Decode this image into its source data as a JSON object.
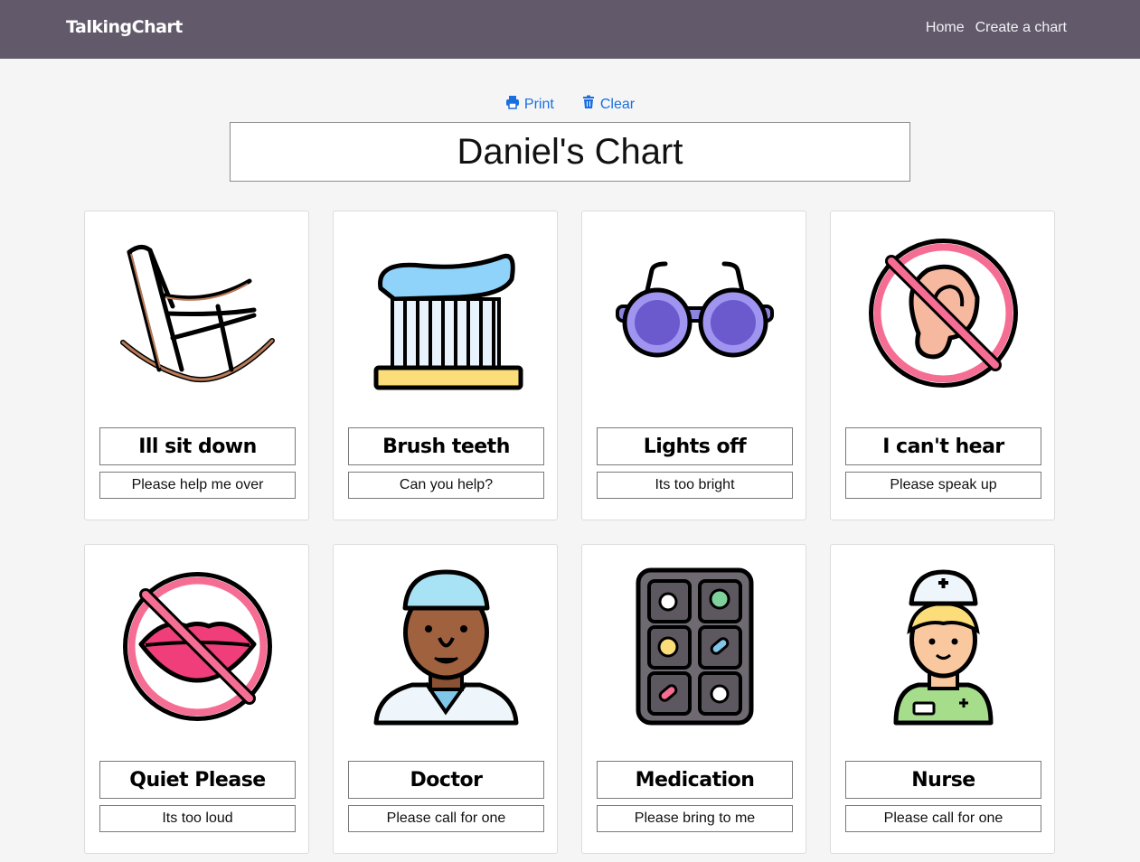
{
  "nav": {
    "brand": "TalkingChart",
    "links": [
      "Home",
      "Create a chart"
    ]
  },
  "toolbar": {
    "print_label": "Print",
    "clear_label": "Clear",
    "print_icon": "printer-icon",
    "clear_icon": "trash-icon"
  },
  "chart_title": "Daniel's Chart",
  "colors": {
    "navbar": "#625a6b",
    "action_link": "#1a6fe0",
    "background": "#f5f5f5"
  },
  "cards": [
    {
      "label": "Ill sit down",
      "subtitle": "Please help me over",
      "icon": "rocking-chair-icon"
    },
    {
      "label": "Brush teeth",
      "subtitle": "Can you help?",
      "icon": "toothbrush-icon"
    },
    {
      "label": "Lights off",
      "subtitle": "Its too bright",
      "icon": "sunglasses-icon"
    },
    {
      "label": "I can't hear",
      "subtitle": "Please speak up",
      "icon": "no-hearing-icon"
    },
    {
      "label": "Quiet Please",
      "subtitle": "Its too loud",
      "icon": "no-talking-icon"
    },
    {
      "label": "Doctor",
      "subtitle": "Please call for one",
      "icon": "doctor-icon"
    },
    {
      "label": "Medication",
      "subtitle": "Please bring to me",
      "icon": "pill-box-icon"
    },
    {
      "label": "Nurse",
      "subtitle": "Please call for one",
      "icon": "nurse-icon"
    }
  ]
}
